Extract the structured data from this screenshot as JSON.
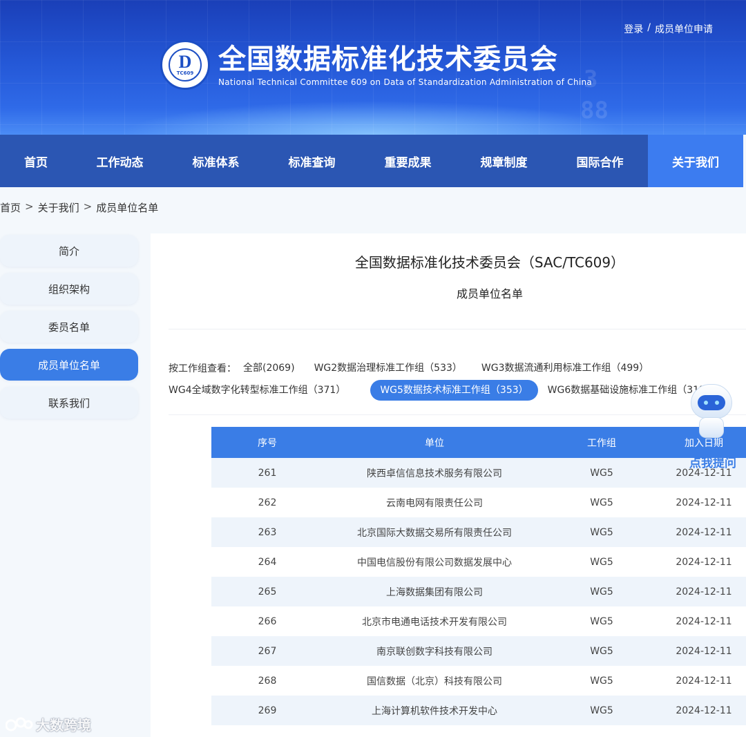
{
  "header": {
    "top_links": {
      "login": "登录",
      "separator": "/",
      "apply": "成员单位申请"
    },
    "logo": {
      "seal_text": "TC609"
    },
    "title_cn": "全国数据标准化技术委员会",
    "title_en": "National Technical Committee 609 on Data of Standardization Administration of China"
  },
  "nav": {
    "items": [
      {
        "label": "首页"
      },
      {
        "label": "工作动态"
      },
      {
        "label": "标准体系"
      },
      {
        "label": "标准查询"
      },
      {
        "label": "重要成果"
      },
      {
        "label": "规章制度"
      },
      {
        "label": "国际合作"
      },
      {
        "label": "关于我们",
        "active": true
      }
    ]
  },
  "breadcrumb": [
    "首页",
    "关于我们",
    "成员单位名单"
  ],
  "sidebar": {
    "items": [
      {
        "label": "简介"
      },
      {
        "label": "组织架构"
      },
      {
        "label": "委员名单"
      },
      {
        "label": "成员单位名单",
        "active": true
      },
      {
        "label": "联系我们"
      }
    ]
  },
  "main": {
    "title": "全国数据标准化技术委员会（SAC/TC609）",
    "subtitle": "成员单位名单",
    "filter_label": "按工作组查看：",
    "filters": [
      {
        "label": "全部(2069)"
      },
      {
        "label": "WG2数据治理标准工作组（533）"
      },
      {
        "label": "WG3数据流通利用标准工作组（499）"
      },
      {
        "label": "WG4全域数字化转型标准工作组（371）"
      },
      {
        "label": "WG5数据技术标准工作组（353）",
        "active": true
      },
      {
        "label": "WG6数据基础设施标准工作组（313）"
      }
    ],
    "table": {
      "headers": [
        "序号",
        "单位",
        "工作组",
        "加入日期"
      ],
      "rows": [
        [
          "261",
          "陕西卓信信息技术服务有限公司",
          "WG5",
          "2024-12-11"
        ],
        [
          "262",
          "云南电网有限责任公司",
          "WG5",
          "2024-12-11"
        ],
        [
          "263",
          "北京国际大数据交易所有限责任公司",
          "WG5",
          "2024-12-11"
        ],
        [
          "264",
          "中国电信股份有限公司数据发展中心",
          "WG5",
          "2024-12-11"
        ],
        [
          "265",
          "上海数据集团有限公司",
          "WG5",
          "2024-12-11"
        ],
        [
          "266",
          "北京市电通电话技术开发有限公司",
          "WG5",
          "2024-12-11"
        ],
        [
          "267",
          "南京联创数字科技有限公司",
          "WG5",
          "2024-12-11"
        ],
        [
          "268",
          "国信数据（北京）科技有限公司",
          "WG5",
          "2024-12-11"
        ],
        [
          "269",
          "上海计算机软件技术开发中心",
          "WG5",
          "2024-12-11"
        ]
      ]
    }
  },
  "assistant": {
    "label": "点我提问"
  },
  "watermark": {
    "text": "大数跨境"
  },
  "colors": {
    "primary": "#3a7de6",
    "nav_bg": "#2b56b3",
    "row_alt": "#eef4fb"
  }
}
